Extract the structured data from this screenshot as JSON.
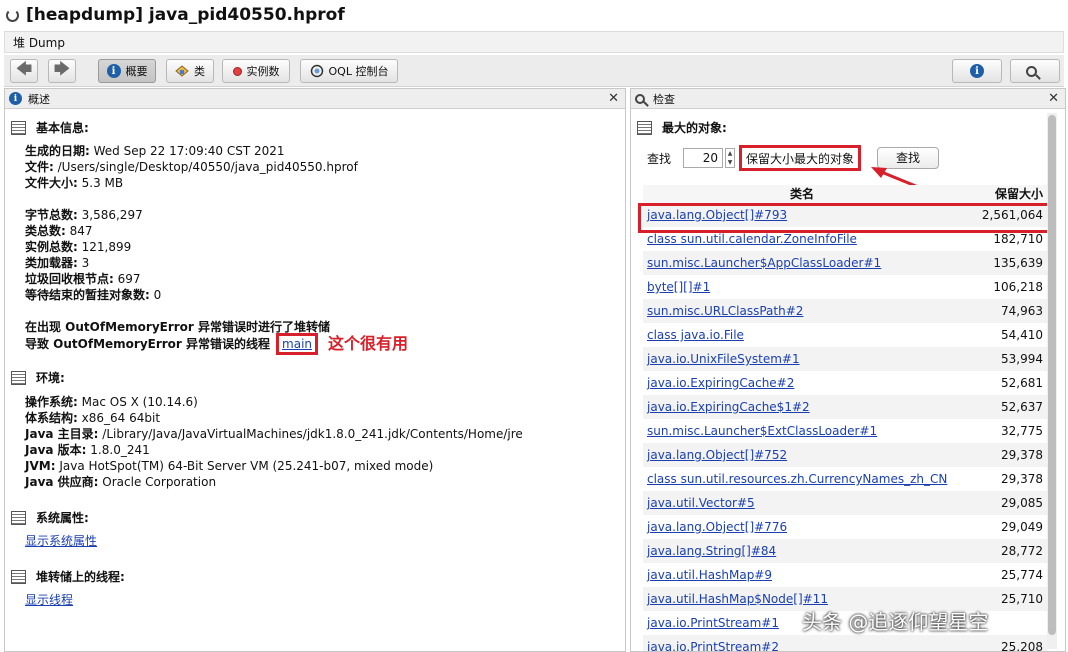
{
  "window": {
    "title": "[heapdump] java_pid40550.hprof"
  },
  "dump_tab": "堆 Dump",
  "toolbar": {
    "summary": "概要",
    "classes": "类",
    "instances": "实例数",
    "oql": "OQL 控制台"
  },
  "left_panel": {
    "title": "概述",
    "basic_info": {
      "heading": "基本信息:",
      "date_label": "生成的日期:",
      "date_value": "Wed Sep 22 17:09:40 CST 2021",
      "file_label": "文件:",
      "file_value": "/Users/single/Desktop/40550/java_pid40550.hprof",
      "size_label": "文件大小:",
      "size_value": "5.3 MB",
      "bytes_label": "字节总数:",
      "bytes_value": "3,586,297",
      "classes_label": "类总数:",
      "classes_value": "847",
      "instances_label": "实例总数:",
      "instances_value": "121,899",
      "loaders_label": "类加载器:",
      "loaders_value": "3",
      "gcroots_label": "垃圾回收根节点:",
      "gcroots_value": "697",
      "pending_label": "等待结束的暂挂对象数:",
      "pending_value": "0",
      "oom_line": "在出现 OutOfMemoryError 异常错误时进行了堆转储",
      "thread_line": "导致 OutOfMemoryError 异常错误的线程",
      "thread_link": "main",
      "annotation": "这个很有用"
    },
    "env": {
      "heading": "环境:",
      "os_label": "操作系统:",
      "os_value": "Mac OS X (10.14.6)",
      "arch_label": "体系结构:",
      "arch_value": "x86_64 64bit",
      "home_label": "Java 主目录:",
      "home_value": "/Library/Java/JavaVirtualMachines/jdk1.8.0_241.jdk/Contents/Home/jre",
      "version_label": "Java 版本:",
      "version_value": "1.8.0_241",
      "jvm_label": "JVM:",
      "jvm_value": "Java HotSpot(TM) 64-Bit Server VM (25.241-b07, mixed mode)",
      "vendor_label": "Java 供应商:",
      "vendor_value": "Oracle Corporation"
    },
    "sysprops": {
      "heading": "系统属性:",
      "link": "显示系统属性"
    },
    "threads": {
      "heading": "堆转储上的线程:",
      "link": "显示线程"
    }
  },
  "right_panel": {
    "title": "检查",
    "heading": "最大的对象:",
    "find_label": "查找",
    "count": "20",
    "mode": "保留大小最大的对象",
    "find_button": "查找",
    "columns": [
      "类名",
      "保留大小"
    ],
    "rows": [
      {
        "name": "java.lang.Object[]#793",
        "size": "2,561,064"
      },
      {
        "name": "class sun.util.calendar.ZoneInfoFile",
        "size": "182,710"
      },
      {
        "name": "sun.misc.Launcher$AppClassLoader#1",
        "size": "135,639"
      },
      {
        "name": "byte[][]#1",
        "size": "106,218"
      },
      {
        "name": "sun.misc.URLClassPath#2",
        "size": "74,963"
      },
      {
        "name": "class java.io.File",
        "size": "54,410"
      },
      {
        "name": "java.io.UnixFileSystem#1",
        "size": "53,994"
      },
      {
        "name": "java.io.ExpiringCache#2",
        "size": "52,681"
      },
      {
        "name": "java.io.ExpiringCache$1#2",
        "size": "52,637"
      },
      {
        "name": "sun.misc.Launcher$ExtClassLoader#1",
        "size": "32,775"
      },
      {
        "name": "java.lang.Object[]#752",
        "size": "29,378"
      },
      {
        "name": "class sun.util.resources.zh.CurrencyNames_zh_CN",
        "size": "29,378"
      },
      {
        "name": "java.util.Vector#5",
        "size": "29,085"
      },
      {
        "name": "java.lang.Object[]#776",
        "size": "29,049"
      },
      {
        "name": "java.lang.String[]#84",
        "size": "28,772"
      },
      {
        "name": "java.util.HashMap#9",
        "size": "25,774"
      },
      {
        "name": "java.util.HashMap$Node[]#11",
        "size": "25,710"
      },
      {
        "name": "java.io.PrintStream#1",
        "size": ""
      },
      {
        "name": "java.io.PrintStream#2",
        "size": "25,208"
      }
    ]
  },
  "watermark": "头条 @追逐仰望星空"
}
